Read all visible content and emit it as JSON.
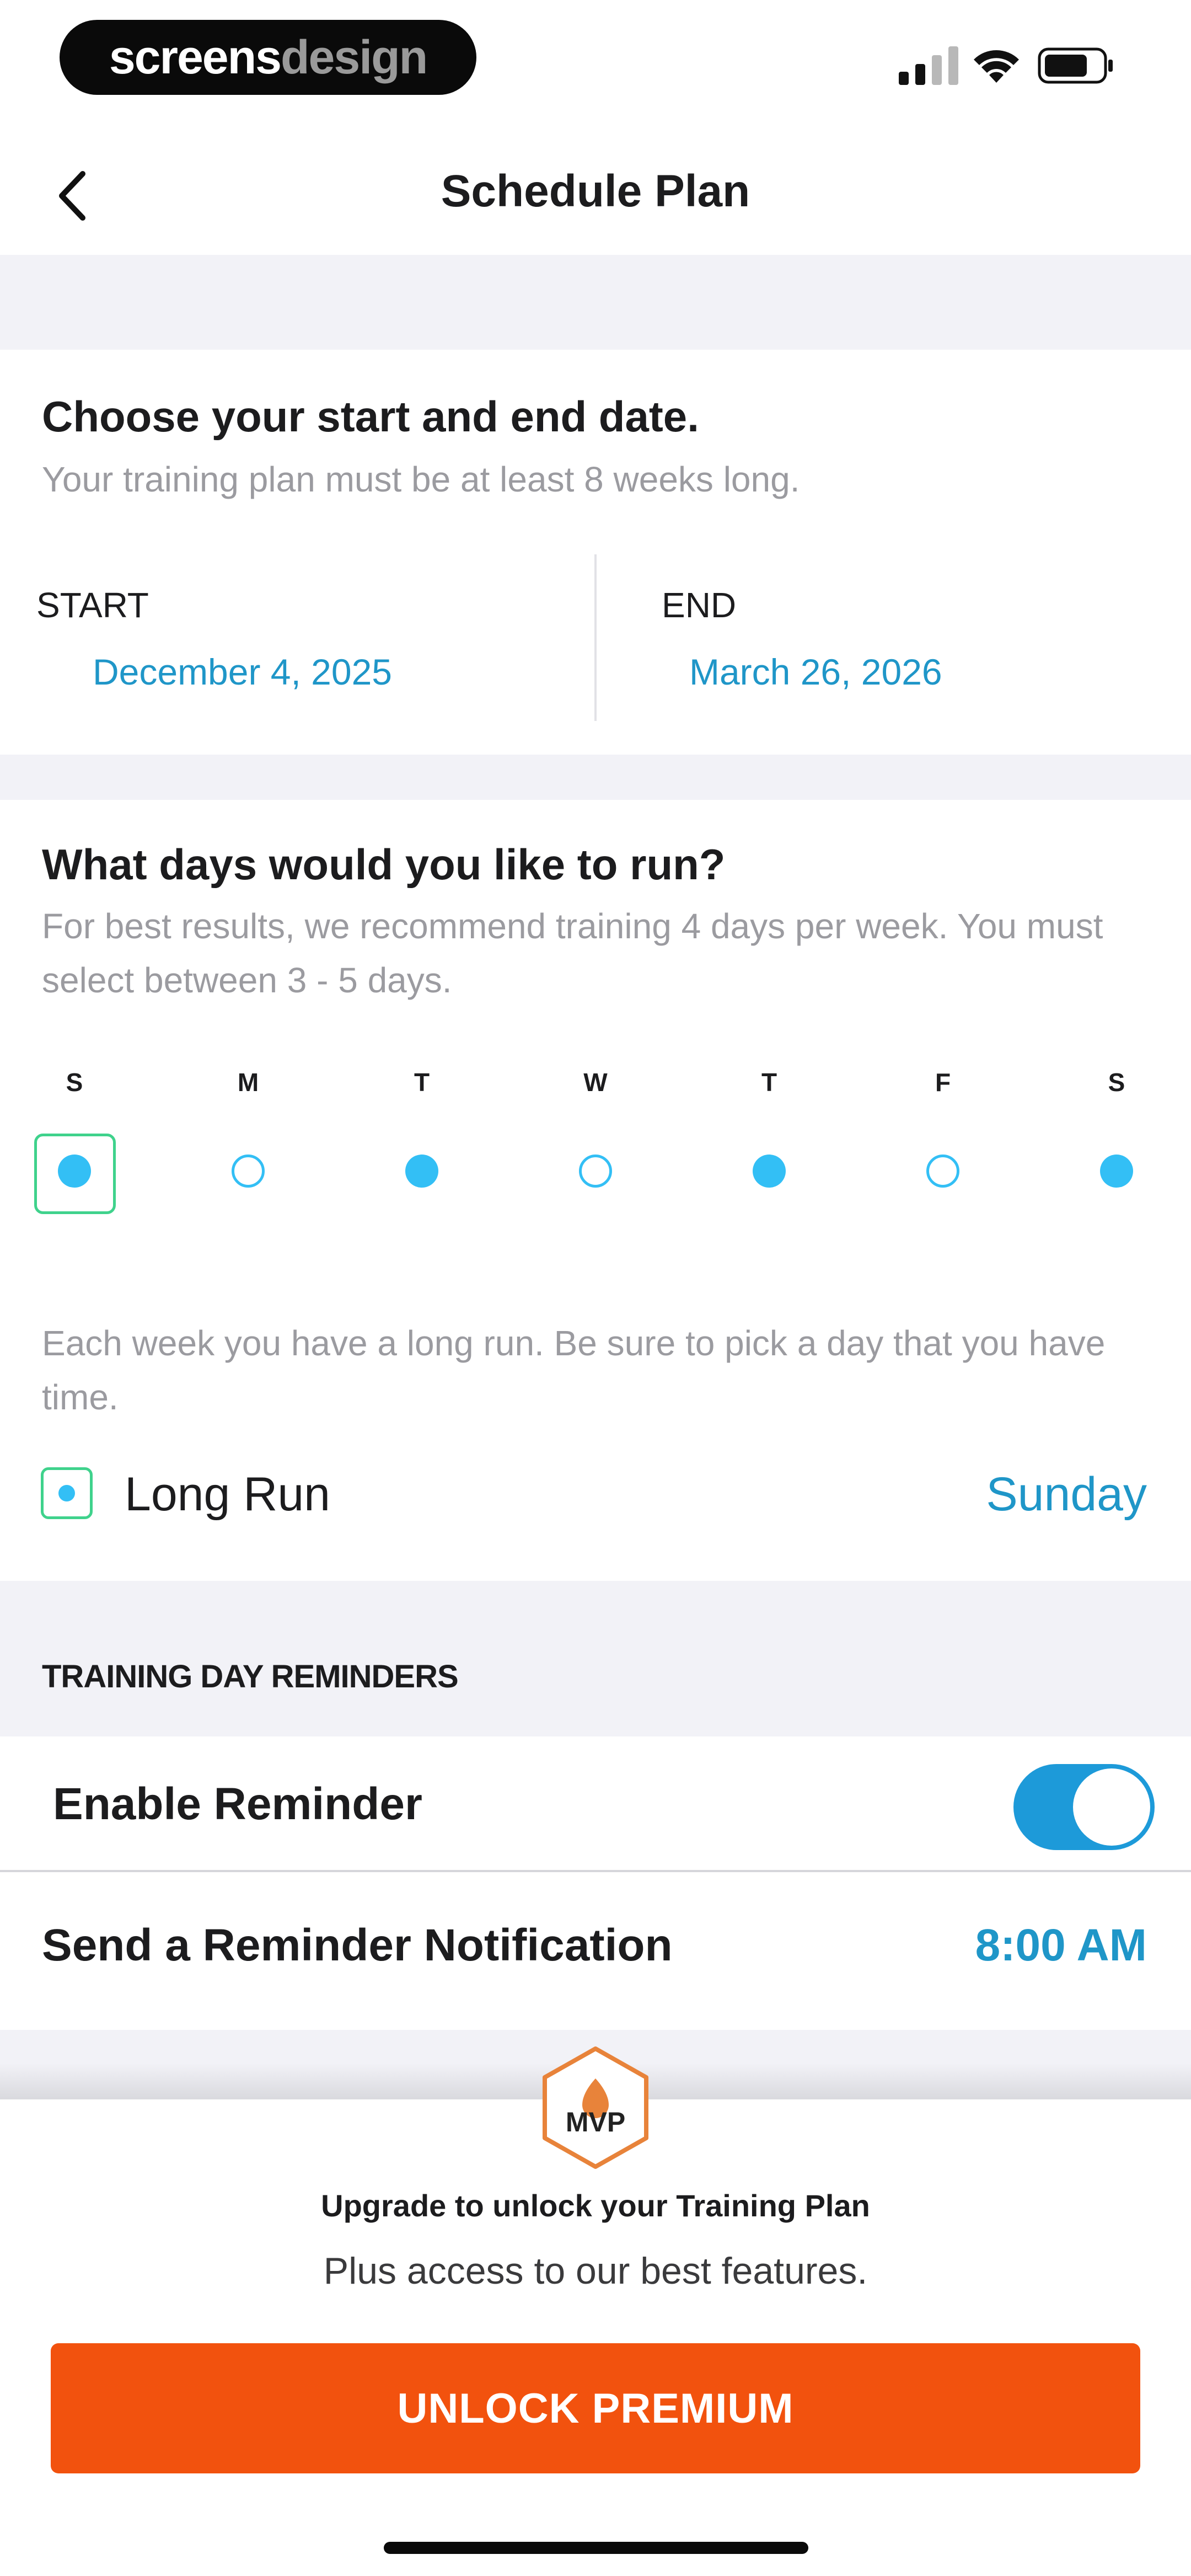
{
  "status_bar": {
    "brand_part1": "screens",
    "brand_part2": "design",
    "icons": [
      "cellular-signal-icon",
      "wifi-icon",
      "battery-icon"
    ]
  },
  "nav": {
    "back_icon": "chevron-left-icon",
    "title": "Schedule Plan"
  },
  "dates": {
    "heading": "Choose your start and end date.",
    "subtitle": "Your training plan must be at least 8 weeks long.",
    "start_label": "START",
    "start_value": "December 4, 2025",
    "end_label": "END",
    "end_value": "March 26, 2026"
  },
  "days": {
    "heading": "What days would you like to run?",
    "subtitle": "For best results, we recommend training 4 days per week. You must select between 3 - 5 days.",
    "items": [
      {
        "letter": "S",
        "selected": true
      },
      {
        "letter": "M",
        "selected": false
      },
      {
        "letter": "T",
        "selected": true
      },
      {
        "letter": "W",
        "selected": false
      },
      {
        "letter": "T",
        "selected": true
      },
      {
        "letter": "F",
        "selected": false
      },
      {
        "letter": "S",
        "selected": true
      }
    ],
    "long_run_note": "Each week you have a long run. Be sure to pick a day that you have time.",
    "long_run_label": "Long Run",
    "long_run_value": "Sunday"
  },
  "reminders": {
    "section_title": "TRAINING DAY REMINDERS",
    "enable_label": "Enable Reminder",
    "enabled": true,
    "notify_label": "Send a Reminder Notification",
    "notify_time": "8:00 AM"
  },
  "upgrade": {
    "badge_text": "MVP",
    "title": "Upgrade to unlock your Training Plan",
    "subtitle": "Plus access to our best features.",
    "cta": "UNLOCK PREMIUM"
  },
  "colors": {
    "accent_blue": "#1f96c8",
    "dot_blue": "#33bff5",
    "select_green": "#3fd28c",
    "cta_orange": "#f2520e",
    "badge_orange": "#e8833a"
  }
}
